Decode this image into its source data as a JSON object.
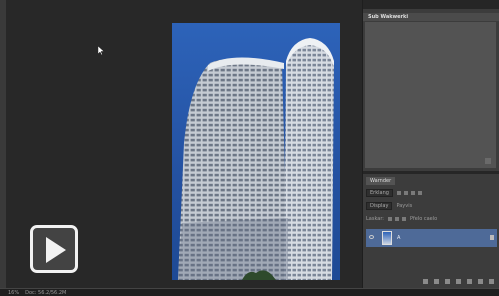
{
  "app": {
    "zoom_label": "16%",
    "doc_label": "Doc: 56.2/56.2M"
  },
  "panels": {
    "upper": {
      "title": "Sub Wakwerki"
    },
    "layers": {
      "tab_label": "Warnder",
      "mode": "Erklang",
      "blend": "Display",
      "opacity_label": "Payvis",
      "lock_label": "Laskar:",
      "fill_label": "Pfelo caelo",
      "layer_name": "A"
    }
  },
  "icons": {
    "cursor": "arrow-cursor-icon",
    "play": "play-icon",
    "eye": "eye-icon",
    "lock": "lock-icon"
  }
}
